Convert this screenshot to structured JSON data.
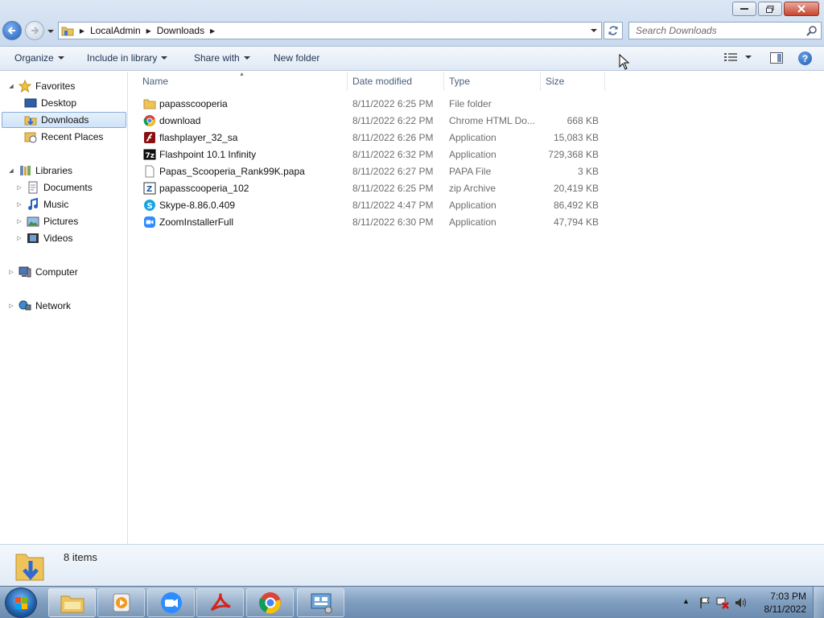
{
  "window": {
    "breadcrumbs": [
      "LocalAdmin",
      "Downloads"
    ],
    "search_placeholder": "Search Downloads"
  },
  "toolbar": {
    "organize": "Organize",
    "include_in_library": "Include in library",
    "share_with": "Share with",
    "new_folder": "New folder"
  },
  "nav": {
    "favorites": "Favorites",
    "desktop": "Desktop",
    "downloads": "Downloads",
    "recent_places": "Recent Places",
    "libraries": "Libraries",
    "documents": "Documents",
    "music": "Music",
    "pictures": "Pictures",
    "videos": "Videos",
    "computer": "Computer",
    "network": "Network"
  },
  "columns": {
    "name": "Name",
    "date_modified": "Date modified",
    "type": "Type",
    "size": "Size"
  },
  "files": [
    {
      "name": "papasscooperia",
      "date": "8/11/2022 6:25 PM",
      "type": "File folder",
      "size": "",
      "icon": "folder-icon"
    },
    {
      "name": "download",
      "date": "8/11/2022 6:22 PM",
      "type": "Chrome HTML Do...",
      "size": "668 KB",
      "icon": "chrome-icon"
    },
    {
      "name": "flashplayer_32_sa",
      "date": "8/11/2022 6:26 PM",
      "type": "Application",
      "size": "15,083 KB",
      "icon": "flash-icon"
    },
    {
      "name": "Flashpoint 10.1 Infinity",
      "date": "8/11/2022 6:32 PM",
      "type": "Application",
      "size": "729,368 KB",
      "icon": "7zip-icon"
    },
    {
      "name": "Papas_Scooperia_Rank99K.papa",
      "date": "8/11/2022 6:27 PM",
      "type": "PAPA File",
      "size": "3 KB",
      "icon": "blank-file-icon"
    },
    {
      "name": "papasscooperia_102",
      "date": "8/11/2022 6:25 PM",
      "type": "zip Archive",
      "size": "20,419 KB",
      "icon": "zip-icon"
    },
    {
      "name": "Skype-8.86.0.409",
      "date": "8/11/2022 4:47 PM",
      "type": "Application",
      "size": "86,492 KB",
      "icon": "skype-icon"
    },
    {
      "name": "ZoomInstallerFull",
      "date": "8/11/2022 6:30 PM",
      "type": "Application",
      "size": "47,794 KB",
      "icon": "zoom-icon"
    }
  ],
  "details": {
    "item_count": "8 items"
  },
  "taskbar": {
    "time": "7:03 PM",
    "date": "8/11/2022"
  }
}
